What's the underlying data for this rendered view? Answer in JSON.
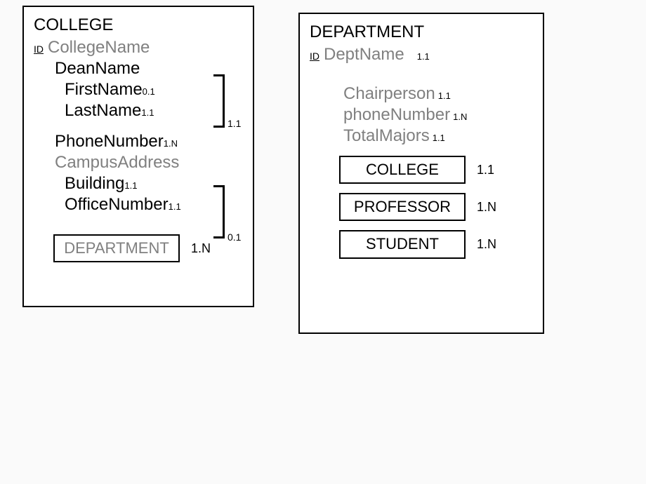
{
  "college": {
    "title": "COLLEGE",
    "id_label": "ID",
    "name_attr": "CollegeName",
    "dean": {
      "label": "DeanName",
      "first": "FirstName",
      "first_card": "0.1",
      "last": "LastName",
      "last_card": "1.1",
      "group_card": "1.1"
    },
    "phone": {
      "label": "PhoneNumber",
      "card": "1.N"
    },
    "address": {
      "label": "CampusAddress",
      "building": "Building",
      "building_card": "1.1",
      "office": "OfficeNumber",
      "office_card": "1.1",
      "group_card": "0.1"
    },
    "rel": {
      "label": "DEPARTMENT",
      "card": "1.N"
    }
  },
  "department": {
    "title": "DEPARTMENT",
    "id_label": "ID",
    "name_attr": "DeptName",
    "name_card": "1.1",
    "chair": {
      "label": "Chairperson",
      "card": "1.1"
    },
    "phone": {
      "label": "phoneNumber",
      "card": "1.N"
    },
    "majors": {
      "label": "TotalMajors",
      "card": "1.1"
    },
    "rels": [
      {
        "label": "COLLEGE",
        "card": "1.1"
      },
      {
        "label": "PROFESSOR",
        "card": "1.N"
      },
      {
        "label": "STUDENT",
        "card": "1.N"
      }
    ]
  }
}
